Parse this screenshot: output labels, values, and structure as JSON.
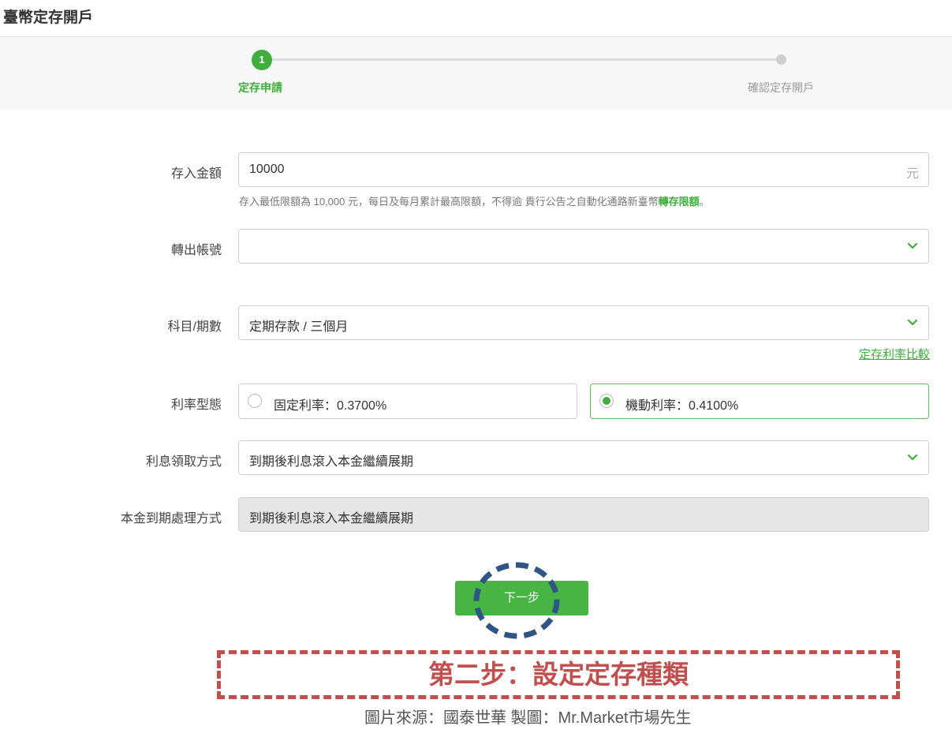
{
  "header": {
    "title": "臺幣定存開戶"
  },
  "stepper": {
    "steps": [
      {
        "number": "1",
        "label": "定存申請",
        "active": true
      },
      {
        "number": "",
        "label": "確認定存開戶",
        "active": false
      }
    ]
  },
  "form": {
    "amount": {
      "label": "存入金額",
      "value": "10000",
      "unit": "元"
    },
    "amount_hint": {
      "text": "存入最低限額為 10,000 元，每日及每月累計最高限額，不得逾 貴行公告之自動化通路新臺幣",
      "link": "轉存限額",
      "tail": "。"
    },
    "account": {
      "label": "轉出帳號",
      "value": ""
    },
    "term": {
      "label": "科目/期數",
      "value": "定期存款 / 三個月"
    },
    "rate_compare_link": "定存利率比較",
    "rate_type": {
      "label": "利率型態",
      "options": [
        {
          "label": "固定利率：0.3700%",
          "selected": false
        },
        {
          "label": "機動利率：0.4100%",
          "selected": true
        }
      ]
    },
    "interest_method": {
      "label": "利息領取方式",
      "value": "到期後利息滾入本金繼續展期"
    },
    "maturity_method": {
      "label": "本金到期處理方式",
      "value": "到期後利息滾入本金繼續展期"
    }
  },
  "actions": {
    "next_label": "下一步"
  },
  "annotation": {
    "banner": "第二步：設定定存種類",
    "source": "圖片來源：國泰世華 製圖：Mr.Market市場先生"
  },
  "colors": {
    "accent": "#3fae3c",
    "annotation_red": "#c0504d",
    "annotation_blue": "#2f5486"
  }
}
